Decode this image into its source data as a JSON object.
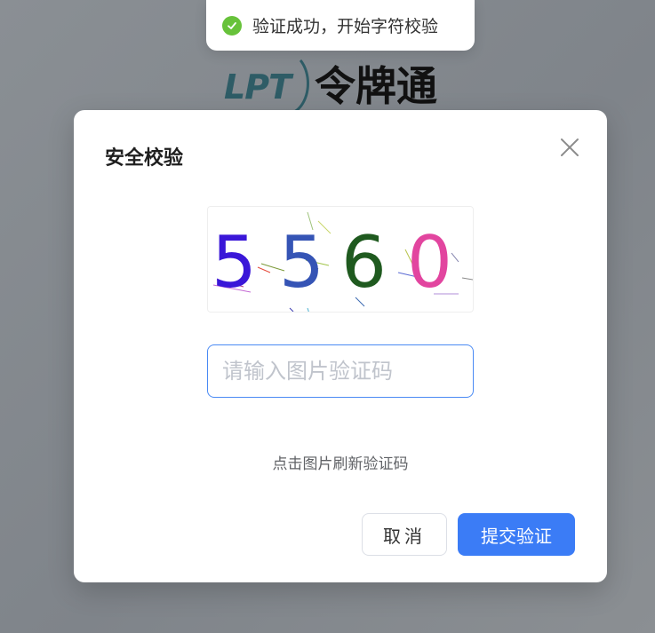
{
  "toast": {
    "message": "验证成功，开始字符校验",
    "icon": "check-circle-icon",
    "color": "#67c23a"
  },
  "background": {
    "logo_text": "LPT",
    "app_title": "令牌通"
  },
  "dialog": {
    "title": "安全校验",
    "close_icon": "close-icon",
    "captcha": {
      "text": "5560",
      "chars": [
        {
          "char": "5",
          "color": "#3a17d8"
        },
        {
          "char": "5",
          "color": "#3554b5"
        },
        {
          "char": "6",
          "color": "#1f5a1f"
        },
        {
          "char": "0",
          "color": "#e2459f"
        }
      ]
    },
    "input": {
      "placeholder": "请输入图片验证码",
      "value": ""
    },
    "hint": "点击图片刷新验证码",
    "cancel_label": "取消",
    "submit_label": "提交验证",
    "accent_color": "#3b7cf6"
  }
}
